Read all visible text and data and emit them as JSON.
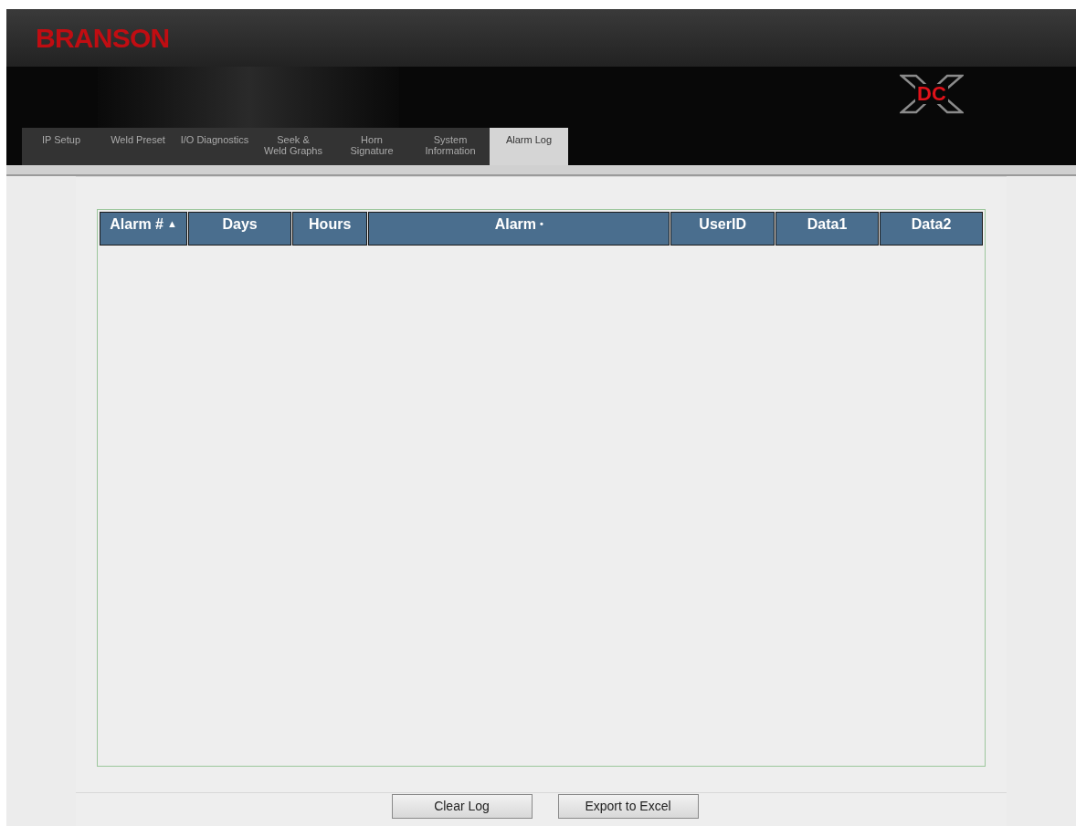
{
  "header": {
    "brand": "BRANSON",
    "product_logo": "DC"
  },
  "tabs": [
    {
      "label": "IP Setup",
      "selected": false
    },
    {
      "label": "Weld Preset",
      "selected": false
    },
    {
      "label": "I/O Diagnostics",
      "selected": false
    },
    {
      "label": "Seek &\nWeld Graphs",
      "selected": false
    },
    {
      "label": "Horn\nSignature",
      "selected": false
    },
    {
      "label": "System\nInformation",
      "selected": false
    },
    {
      "label": "Alarm Log",
      "selected": true
    }
  ],
  "table": {
    "columns": [
      {
        "label": "Alarm #",
        "marker": "▲"
      },
      {
        "label": "Days"
      },
      {
        "label": "Hours"
      },
      {
        "label": "Alarm",
        "marker": "•"
      },
      {
        "label": "UserID"
      },
      {
        "label": "Data1"
      },
      {
        "label": "Data2"
      }
    ]
  },
  "buttons": [
    "Clear Log",
    "Export to Excel"
  ]
}
